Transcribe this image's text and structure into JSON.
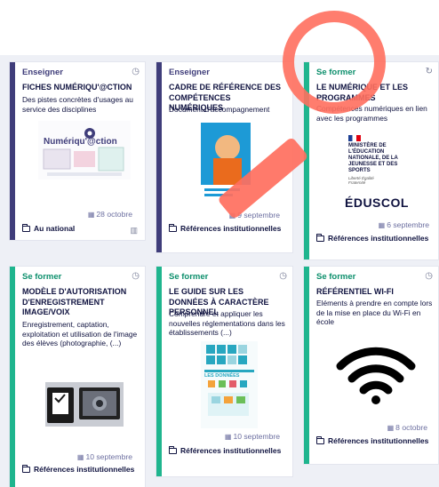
{
  "cards": [
    {
      "category": "Enseigner",
      "title": "FICHES NUMÉRIQU'@CTION",
      "desc": "Des pistes concrètes d'usages au service des disciplines",
      "thumb_label": "Numériqu'@ction",
      "date": "28 octobre",
      "tag": "Au national"
    },
    {
      "category": "Enseigner",
      "title": "CADRE DE RÉFÉRENCE DES COMPÉTENCES NUMÉRIQUES",
      "desc": "Document d'accompagnement",
      "date": "9 septembre",
      "tag": "Références institutionnelles"
    },
    {
      "category": "Se former",
      "title": "LE NUMÉRIQUE ET LES PROGRAMMES",
      "desc": "Compétences numériques en lien avec les programmes",
      "ministry": "MINISTÈRE DE L'ÉDUCATION NATIONALE, DE LA JEUNESSE ET DES SPORTS",
      "ministry_motto": "Liberté Égalité Fraternité",
      "thumb_label": "ÉDUSCOL",
      "date": "6 septembre",
      "tag": "Références institutionnelles"
    },
    {
      "category": "Se former",
      "title": "MODÈLE D'AUTORISATION D'ENREGISTREMENT IMAGE/VOIX",
      "desc": "Enregistrement, captation, exploitation et utilisation de l'image des élèves (photographie, (...)",
      "date": "10 septembre",
      "tag": "Références institutionnelles"
    },
    {
      "category": "Se former",
      "title": "LE GUIDE SUR LES DONNÉES À CARACTÈRE PERSONNEL",
      "desc": "Comprendre et appliquer les nouvelles réglementations dans les établissements (...)",
      "thumb_label": "LES DONNÉES",
      "date": "10 septembre",
      "tag": "Références institutionnelles"
    },
    {
      "category": "Se former",
      "title": "RÉFÉRENTIEL WI-FI",
      "desc": "Eléments à prendre en compte lors de la mise en place du Wi-Fi en école",
      "date": "8 octobre",
      "tag": "Références institutionnelles"
    }
  ],
  "icons": {
    "clock": "clock-icon",
    "refresh": "refresh-icon",
    "calendar": "calendar-icon",
    "folder": "folder-icon",
    "book": "book-icon",
    "magnifier": "magnifier-overlay"
  },
  "colors": {
    "enseigner": "#3f3d7a",
    "se_former": "#1fb58e",
    "magnifier": "#ff6f5e"
  }
}
